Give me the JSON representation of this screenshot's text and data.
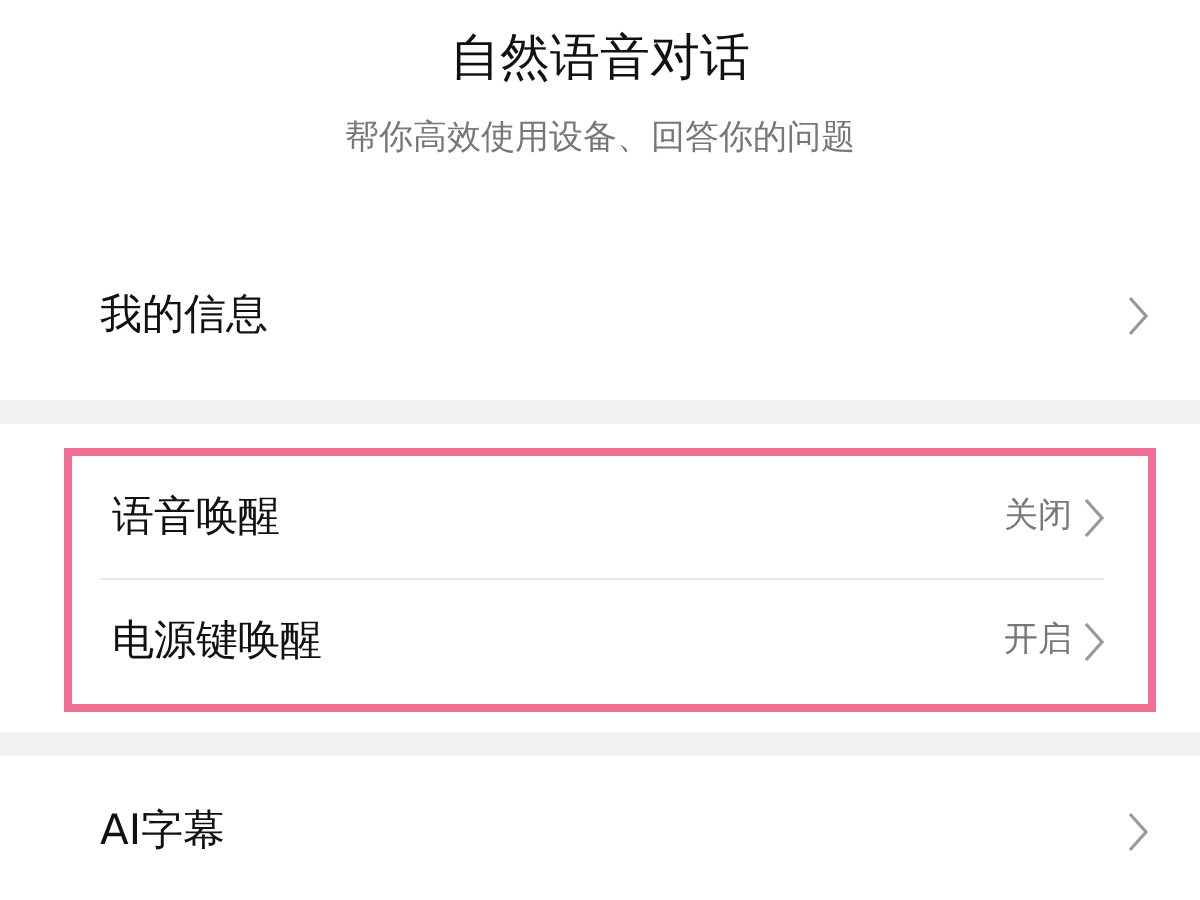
{
  "header": {
    "title": "自然语音对话",
    "subtitle": "帮你高效使用设备、回答你的问题"
  },
  "sections": [
    {
      "highlighted": false,
      "items": [
        {
          "label": "我的信息"
        }
      ]
    },
    {
      "highlighted": true,
      "items": [
        {
          "label": "语音唤醒",
          "value": "关闭"
        },
        {
          "label": "电源键唤醒",
          "value": "开启"
        }
      ]
    },
    {
      "highlighted": false,
      "items": [
        {
          "label": "AI字幕"
        }
      ]
    }
  ]
}
